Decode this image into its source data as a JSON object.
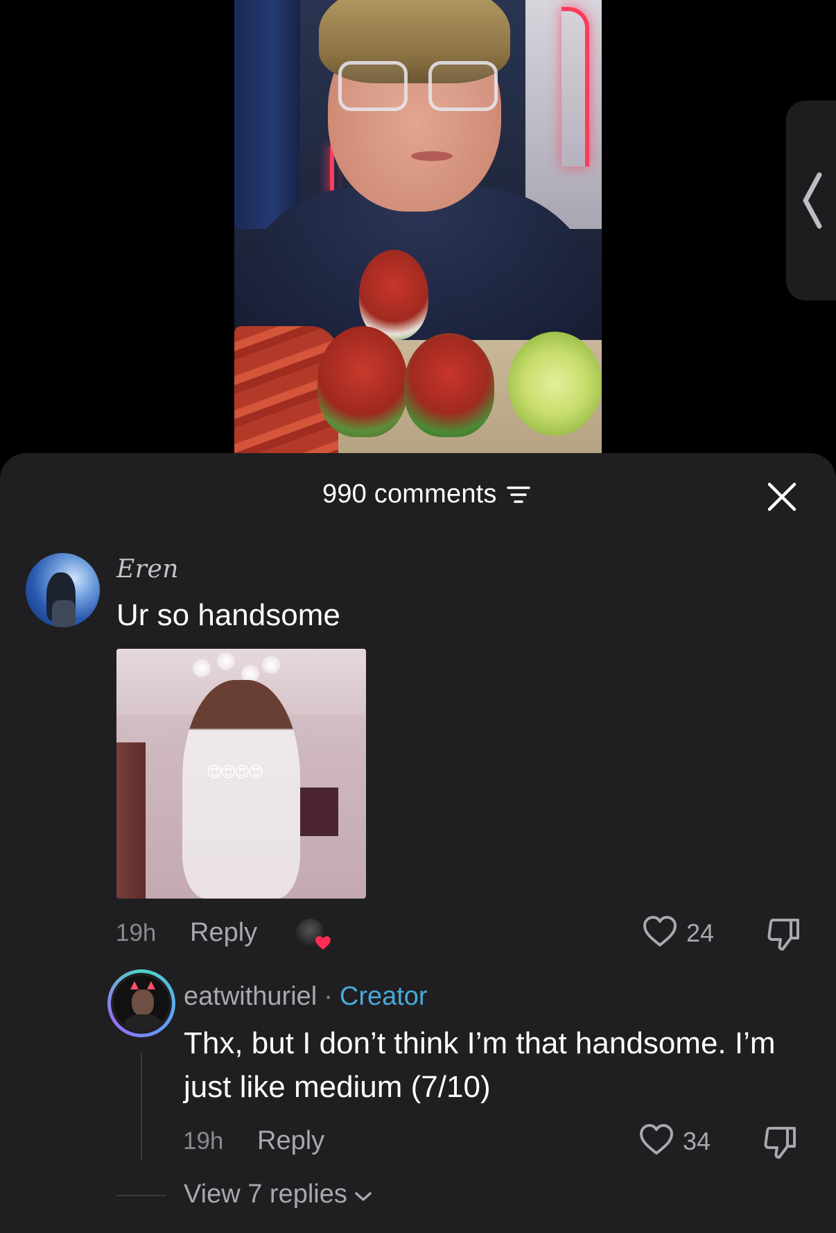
{
  "comments_header": {
    "count_label": "990 comments"
  },
  "comments": [
    {
      "username": "Eren",
      "text": "Ur so handsome",
      "time": "19h",
      "reply_label": "Reply",
      "likes": "24",
      "image_emoji": "😍😍😍😍"
    }
  ],
  "reply": {
    "username": "eatwithuriel",
    "separator": "·",
    "badge": "Creator",
    "text": "Thx, but I don’t think I’m that handsome. I’m just like medium (7/10)",
    "time": "19h",
    "reply_label": "Reply",
    "likes": "34"
  },
  "view_replies_label": "View 7 replies",
  "colors": {
    "sheet_bg": "#1f1f21",
    "creator_badge": "#4aa8d8",
    "creator_heart": "#fe2c55"
  },
  "icons": {
    "filter": "filter-icon",
    "close": "close-icon",
    "like": "heart-outline-icon",
    "dislike": "thumbs-down-icon",
    "chevron": "chevron-down-icon",
    "side": "chevron-left-icon"
  }
}
